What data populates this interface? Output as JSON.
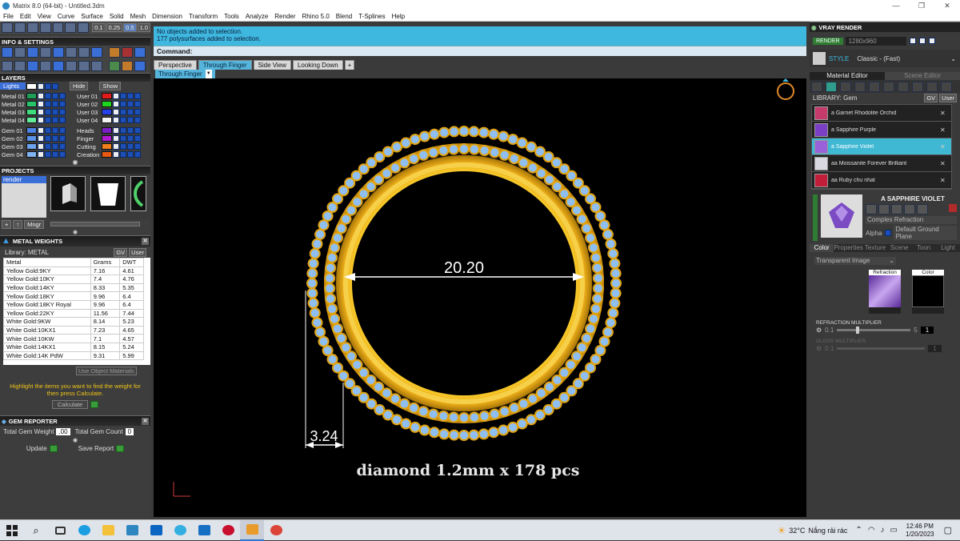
{
  "window": {
    "title": "Matrix 8.0 (64-bit) - Untitled.3dm",
    "controls": [
      "—",
      "❐",
      "✕"
    ]
  },
  "menu": [
    "File",
    "Edit",
    "View",
    "Curve",
    "Surface",
    "Solid",
    "Mesh",
    "Dimension",
    "Transform",
    "Tools",
    "Analyze",
    "Render",
    "Rhino 5.0",
    "Blend",
    "T-Splines",
    "Help"
  ],
  "toolbar_top": {
    "values": [
      "0.1",
      "0.25",
      "0.5",
      "1.0"
    ]
  },
  "info_settings": {
    "title": "INFO & SETTINGS"
  },
  "layers": {
    "title": "LAYERS",
    "lights_label": "Lights",
    "hide_label": "Hide",
    "show_label": "Show",
    "left": [
      {
        "name": "Metal 01",
        "color": "#1f9f55"
      },
      {
        "name": "Metal 02",
        "color": "#27c46a"
      },
      {
        "name": "Metal 03",
        "color": "#3fdc7c"
      },
      {
        "name": "Metal 04",
        "color": "#62ec97"
      },
      {
        "name": "Gem 01",
        "color": "#4d83e6"
      },
      {
        "name": "Gem 02",
        "color": "#5c92ea"
      },
      {
        "name": "Gem 03",
        "color": "#6da2ee"
      },
      {
        "name": "Gem 04",
        "color": "#80b3f2"
      }
    ],
    "right": [
      {
        "name": "User 01",
        "color": "#e21b1b"
      },
      {
        "name": "User 02",
        "color": "#1fd41f"
      },
      {
        "name": "User 03",
        "color": "#2440e8"
      },
      {
        "name": "User 04",
        "color": "#f2f2f2"
      },
      {
        "name": "Heads",
        "color": "#7b1ec8"
      },
      {
        "name": "Finger",
        "color": "#b21bd6"
      },
      {
        "name": "Cutting",
        "color": "#f07e1a"
      },
      {
        "name": "Creation",
        "color": "#e85a14"
      }
    ]
  },
  "projects": {
    "title": "PROJECTS",
    "items": [
      "render"
    ],
    "mngr_label": "Mngr"
  },
  "metal_weights": {
    "title": "METAL WEIGHTS",
    "library_label": "Library: METAL",
    "chips": [
      "GV",
      "User"
    ],
    "columns": [
      "Metal",
      "Grams",
      "DWT"
    ],
    "rows": [
      [
        "Yellow Gold:9KY",
        "7.16",
        "4.61"
      ],
      [
        "Yellow Gold:10KY",
        "7.4",
        "4.76"
      ],
      [
        "Yellow Gold:14KY",
        "8.33",
        "5.35"
      ],
      [
        "Yellow Gold:18KY",
        "9.96",
        "6.4"
      ],
      [
        "Yellow Gold:18KY Royal",
        "9.96",
        "6.4"
      ],
      [
        "Yellow Gold:22KY",
        "11.56",
        "7.44"
      ],
      [
        "White Gold:9KW",
        "8.14",
        "5.23"
      ],
      [
        "White Gold:10KX1",
        "7.23",
        "4.65"
      ],
      [
        "White Gold:10KW",
        "7.1",
        "4.57"
      ],
      [
        "White Gold:14KX1",
        "8.15",
        "5.24"
      ],
      [
        "White Gold:14K PdW",
        "9.31",
        "5.99"
      ]
    ],
    "use_materials": "Use Object Materials",
    "hint": "Highlight the items you want to find the weight for then press Calculate.",
    "calculate": "Calculate"
  },
  "gem_reporter": {
    "title": "GEM REPORTER",
    "total_weight_label": "Total Gem Weight",
    "total_weight": ".00",
    "total_count_label": "Total Gem Count",
    "total_count": "0",
    "update": "Update",
    "save_report": "Save Report"
  },
  "command": {
    "history": [
      "No objects added to selection.",
      "177 polysurfaces added to selection."
    ],
    "label": "Command:"
  },
  "viewport_tabs": [
    "Perspective",
    "Through Finger",
    "Side View",
    "Looking Down"
  ],
  "active_view": "Through Finger",
  "viewport": {
    "dim_inner": "20.20",
    "dim_width": "3.24",
    "caption": "diamond 1.2mm x 178 pcs"
  },
  "vray": {
    "title": "VRAY RENDER",
    "render_label": "RENDER",
    "resolution": "1280x960",
    "style_label": "STYLE",
    "style_value": "Classic - (Fast)",
    "tabs": [
      "Material Editor",
      "Scene Editor"
    ],
    "library_label": "LIBRARY: Gem",
    "chips": [
      "GV",
      "User"
    ],
    "materials": [
      {
        "name": "a Garnet Rhodolite Orchid",
        "color": "#c43a6a",
        "selected": false
      },
      {
        "name": "a Sapphire Purple",
        "color": "#7a3fc4",
        "selected": false
      },
      {
        "name": "a Sapphire Violet",
        "color": "#9a62d8",
        "selected": true
      },
      {
        "name": "aa Moissanite Forever Brilliant",
        "color": "#d8d8e0",
        "selected": false
      },
      {
        "name": "aa Ruby chu nhat",
        "color": "#c21e3a",
        "selected": false
      }
    ],
    "preview_title": "A SAPPHIRE VIOLET",
    "preview_type": "Complex Refraction",
    "alpha_label": "Alpha",
    "ground_plane": "Default Ground Plane",
    "prop_tabs": [
      "Color",
      "Properties",
      "Texture",
      "Scene",
      "Toon",
      "Light"
    ],
    "transparent_image": "Transparent Image",
    "refraction_label": "Refraction",
    "color_label": "Color",
    "refraction_multiplier": "REFRACTION MULTIPLIER",
    "mult_min": "0.1",
    "mult_max": "5",
    "mult_value": "1",
    "gloss_multiplier": "GLOSS MULTIPLIER",
    "gloss_min": "0.1",
    "gloss_value": "1"
  },
  "taskbar": {
    "weather_temp": "32°C",
    "weather_text": "Nắng rải rác",
    "time": "12:46 PM",
    "date": "1/20/2023"
  }
}
